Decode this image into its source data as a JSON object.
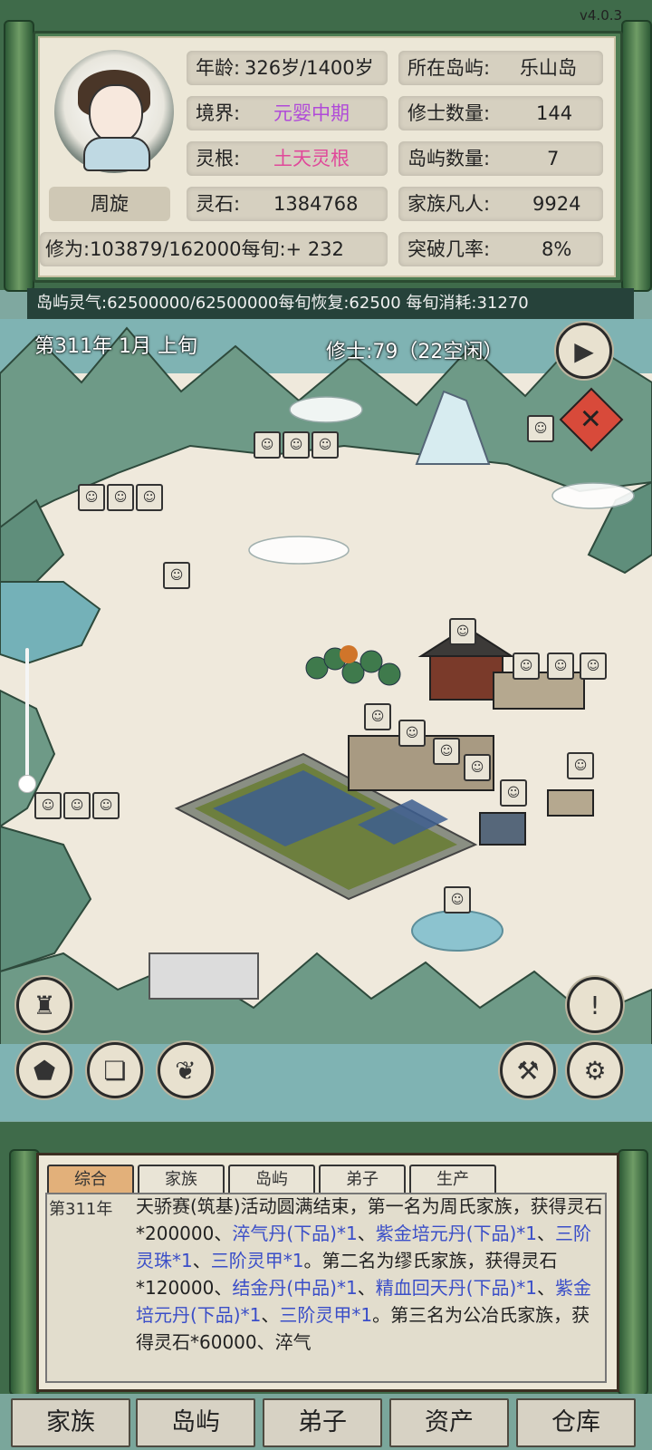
{
  "version": "v4.0.3",
  "profile": {
    "name": "周旋",
    "age_label": "年龄:",
    "age_value": "326岁/1400岁",
    "realm_label": "境界:",
    "realm_value": "元婴中期",
    "root_label": "灵根:",
    "root_value": "土天灵根",
    "stone_label": "灵石:",
    "stone_value": "1384768",
    "cultivation": "修为:103879/162000每旬:+ 232",
    "island_label": "所在岛屿:",
    "island_value": "乐山岛",
    "cultivators_label": "修士数量:",
    "cultivators_value": "144",
    "islands_label": "岛屿数量:",
    "islands_value": "7",
    "mortals_label": "家族凡人:",
    "mortals_value": "9924",
    "breakthrough_label": "突破几率:",
    "breakthrough_value": "8%"
  },
  "qi_bar": "岛屿灵气:62500000/62500000每旬恢复:62500 每旬消耗:31270",
  "map": {
    "date": "第311年 1月 上旬",
    "cultivators": "修士:79（22空闲）"
  },
  "log": {
    "tabs": [
      "综合",
      "家族",
      "岛屿",
      "弟子",
      "生产"
    ],
    "year": "第311年",
    "segments": [
      {
        "text": "天骄赛(筑基)活动圆满结束，第一名为周氏家族，获得灵石*200000、",
        "hl": false
      },
      {
        "text": "淬气丹(下品)*1",
        "hl": true
      },
      {
        "text": "、",
        "hl": false
      },
      {
        "text": "紫金培元丹(下品)*1",
        "hl": true
      },
      {
        "text": "、",
        "hl": false
      },
      {
        "text": "三阶灵珠*1",
        "hl": true
      },
      {
        "text": "、",
        "hl": false
      },
      {
        "text": "三阶灵甲*1",
        "hl": true
      },
      {
        "text": "。第二名为缪氏家族，获得灵石*120000、",
        "hl": false
      },
      {
        "text": "结金丹(中品)*1",
        "hl": true
      },
      {
        "text": "、",
        "hl": false
      },
      {
        "text": "精血回天丹(下品)*1",
        "hl": true
      },
      {
        "text": "、",
        "hl": false
      },
      {
        "text": "紫金培元丹(下品)*1",
        "hl": true
      },
      {
        "text": "、",
        "hl": false
      },
      {
        "text": "三阶灵甲*1",
        "hl": true
      },
      {
        "text": "。第三名为公冶氏家族，获得灵石*60000、淬气",
        "hl": false
      }
    ]
  },
  "nav": [
    "家族",
    "岛屿",
    "弟子",
    "资产",
    "仓库"
  ],
  "icons": {
    "next": "play-arrow-icon",
    "close": "close-icon",
    "figure": "statue-icon",
    "map": "map-icon",
    "craft": "scroll-icon",
    "plant": "plant-icon",
    "alert": "exclamation-icon",
    "hammer": "hammer-icon",
    "settings": "gear-icon"
  },
  "colors": {
    "realm": "#b04ad8",
    "root": "#e0489a",
    "link": "#3a4ec8",
    "active_tab": "#e2b07a"
  }
}
